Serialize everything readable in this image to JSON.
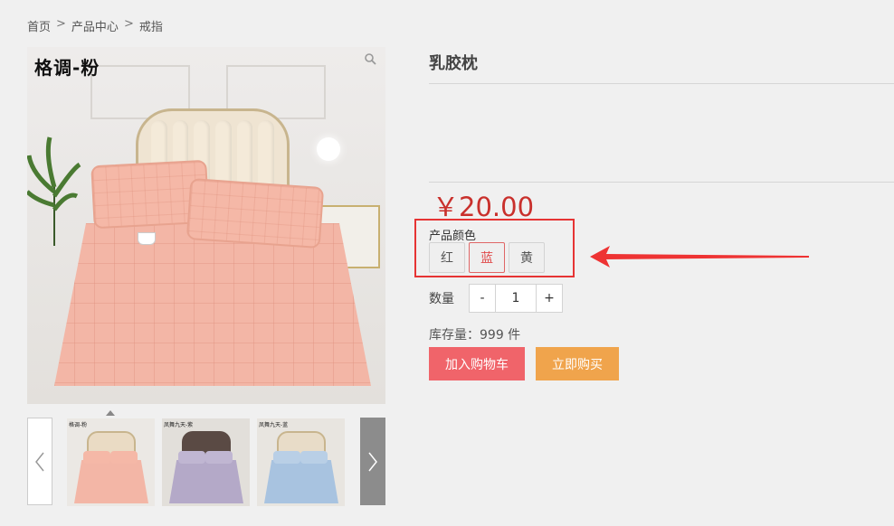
{
  "breadcrumb": {
    "home": "首页",
    "sep": ">",
    "category": "产品中心",
    "current": "戒指"
  },
  "gallery": {
    "main_label": "格调-粉",
    "thumbnails": [
      {
        "label": "格调-粉",
        "bed_color": "#f3b6a6",
        "head_color": "#eadbc4"
      },
      {
        "label": "凤舞九天-紫",
        "bed_color": "#b4a9c8",
        "head_color": "#5a4a44"
      },
      {
        "label": "凤舞九天-蓝",
        "bed_color": "#a8c3e0",
        "head_color": "#e8dcc8"
      }
    ],
    "prev_icon": "chevron-left-icon",
    "next_icon": "chevron-right-icon",
    "zoom_icon": "search-icon"
  },
  "product": {
    "title": "乳胶枕",
    "price": "￥20.00",
    "color_label": "产品颜色",
    "colors": [
      "红",
      "蓝",
      "黄"
    ],
    "selected_color": "蓝",
    "qty_label": "数量",
    "qty_minus": "-",
    "qty_value": "1",
    "qty_plus": "+",
    "stock": "库存量：999 件"
  },
  "actions": {
    "add_to_cart": "加入购物车",
    "buy_now": "立即购买"
  },
  "colors": {
    "price": "#c9302c",
    "cart_button": "#f0646a",
    "buy_button": "#f0a44c",
    "highlight": "#e63434"
  }
}
